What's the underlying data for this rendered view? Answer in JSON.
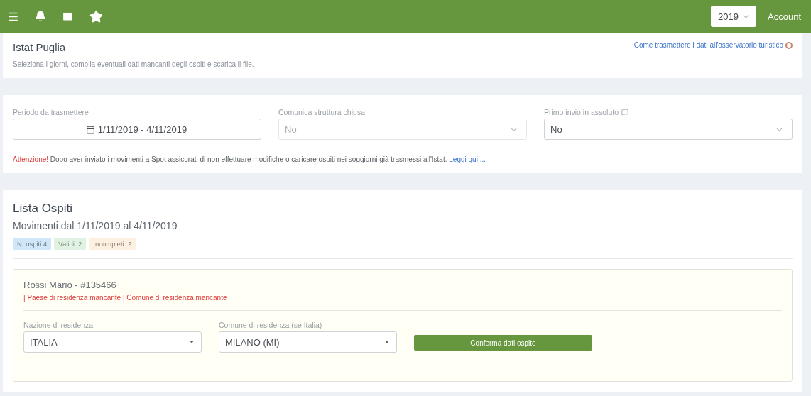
{
  "topbar": {
    "year": "2019",
    "account": "Account"
  },
  "header": {
    "title": "Istat Puglia",
    "subtitle": "Seleziona i giorni, compila eventuali dati mancanti degli ospiti e scarica il file.",
    "help_link": "Come trasmettere i dati all'osservatorio turistico"
  },
  "filters": [
    {
      "kind": "date",
      "label": "Periodo da trasmettere",
      "value": "1/11/2019 - 4/11/2019",
      "disabled": false
    },
    {
      "kind": "select",
      "label": "Comunica struttura chiusa",
      "value": "No",
      "disabled": true
    },
    {
      "kind": "select",
      "label": "Primo invio in assoluto",
      "value": "No",
      "disabled": false,
      "info": true
    }
  ],
  "warning": {
    "label": "Attenzione!",
    "text": "Dopo aver inviato i movimenti a Spot assicurati di non effettuare modifiche o caricare ospiti nei soggiorni già trasmessi all'Istat.",
    "link": "Leggi qui ..."
  },
  "guest_list": {
    "title": "Lista Ospiti",
    "subtitle": "Movimenti dal 1/11/2019 al 4/11/2019",
    "badges": [
      {
        "text": "N. ospiti 4",
        "color": "#cfe7f8"
      },
      {
        "text": "Validi: 2",
        "color": "#e0f3e2"
      },
      {
        "text": "Incompleti: 2",
        "color": "#fdf0e0"
      }
    ],
    "guests": [
      {
        "name": "Rossi Mario - #135466",
        "errors": "| Paese di residenza mancante | Comune di residenza mancante",
        "fields": [
          {
            "label": "Nazione di residenza",
            "value": "ITALIA"
          },
          {
            "label": "Comune di residenza (se Italia)",
            "value": "MILANO (MI)"
          }
        ],
        "button": "Conferma dati ospite"
      }
    ]
  }
}
